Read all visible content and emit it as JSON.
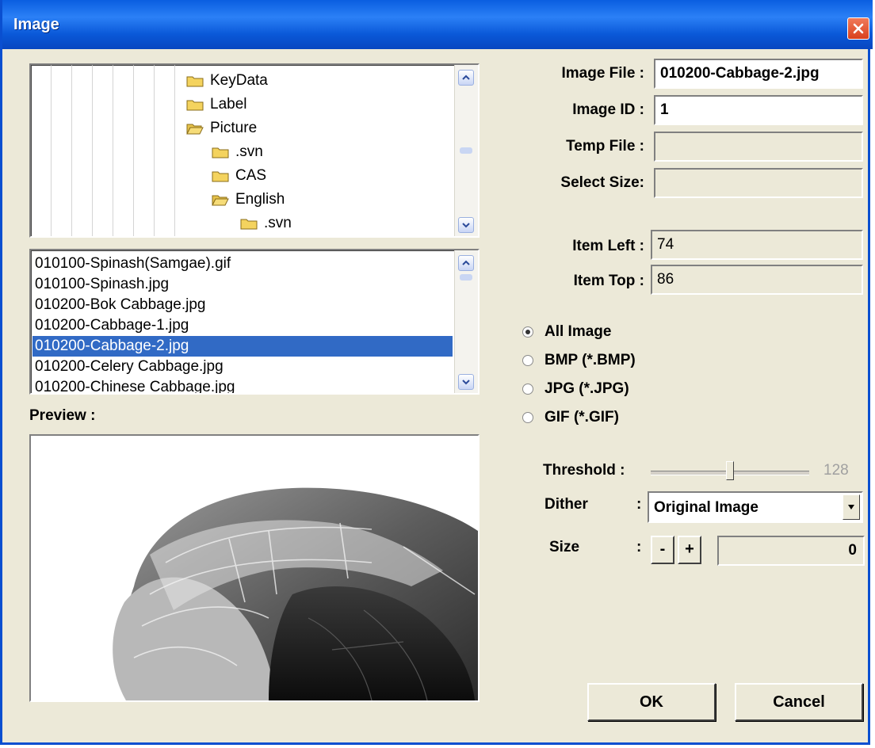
{
  "window": {
    "title": "Image"
  },
  "tree": {
    "items": [
      {
        "label": "KeyData",
        "icon": "folder-closed-icon"
      },
      {
        "label": "Label",
        "icon": "folder-closed-icon"
      },
      {
        "label": "Picture",
        "icon": "folder-open-icon"
      },
      {
        "label": ".svn",
        "icon": "folder-closed-icon"
      },
      {
        "label": "CAS",
        "icon": "folder-closed-icon"
      },
      {
        "label": "English",
        "icon": "folder-open-icon"
      },
      {
        "label": ".svn",
        "icon": "folder-closed-icon"
      }
    ]
  },
  "files": {
    "items": [
      "010100-Spinash(Samgae).gif",
      "010100-Spinash.jpg",
      "010200-Bok Cabbage.jpg",
      "010200-Cabbage-1.jpg",
      "010200-Cabbage-2.jpg",
      "010200-Celery Cabbage.jpg",
      "010200-Chinese Cabbage.jpg"
    ],
    "selected": "010200-Cabbage-2.jpg"
  },
  "preview": {
    "label": "Preview :"
  },
  "form": {
    "image_file_label": "Image File :",
    "image_file_value": "010200-Cabbage-2.jpg",
    "image_id_label": "Image ID :",
    "image_id_value": "1",
    "temp_file_label": "Temp File :",
    "temp_file_value": "",
    "select_size_label": "Select Size:",
    "select_size_value": "",
    "item_left_label": "Item Left :",
    "item_left_value": "74",
    "item_top_label": "Item Top :",
    "item_top_value": "86"
  },
  "filter": {
    "options": [
      "All Image",
      "BMP (*.BMP)",
      "JPG (*.JPG)",
      "GIF (*.GIF)"
    ],
    "selected": "All Image"
  },
  "threshold": {
    "label": "Threshold :",
    "value": "128",
    "level": 128,
    "max": 255
  },
  "dither": {
    "label": "Dither",
    "colon": ":",
    "value": "Original Image"
  },
  "size": {
    "label": "Size",
    "colon": ":",
    "minus": "-",
    "plus": "+",
    "value": "0"
  },
  "buttons": {
    "ok": "OK",
    "cancel": "Cancel"
  }
}
